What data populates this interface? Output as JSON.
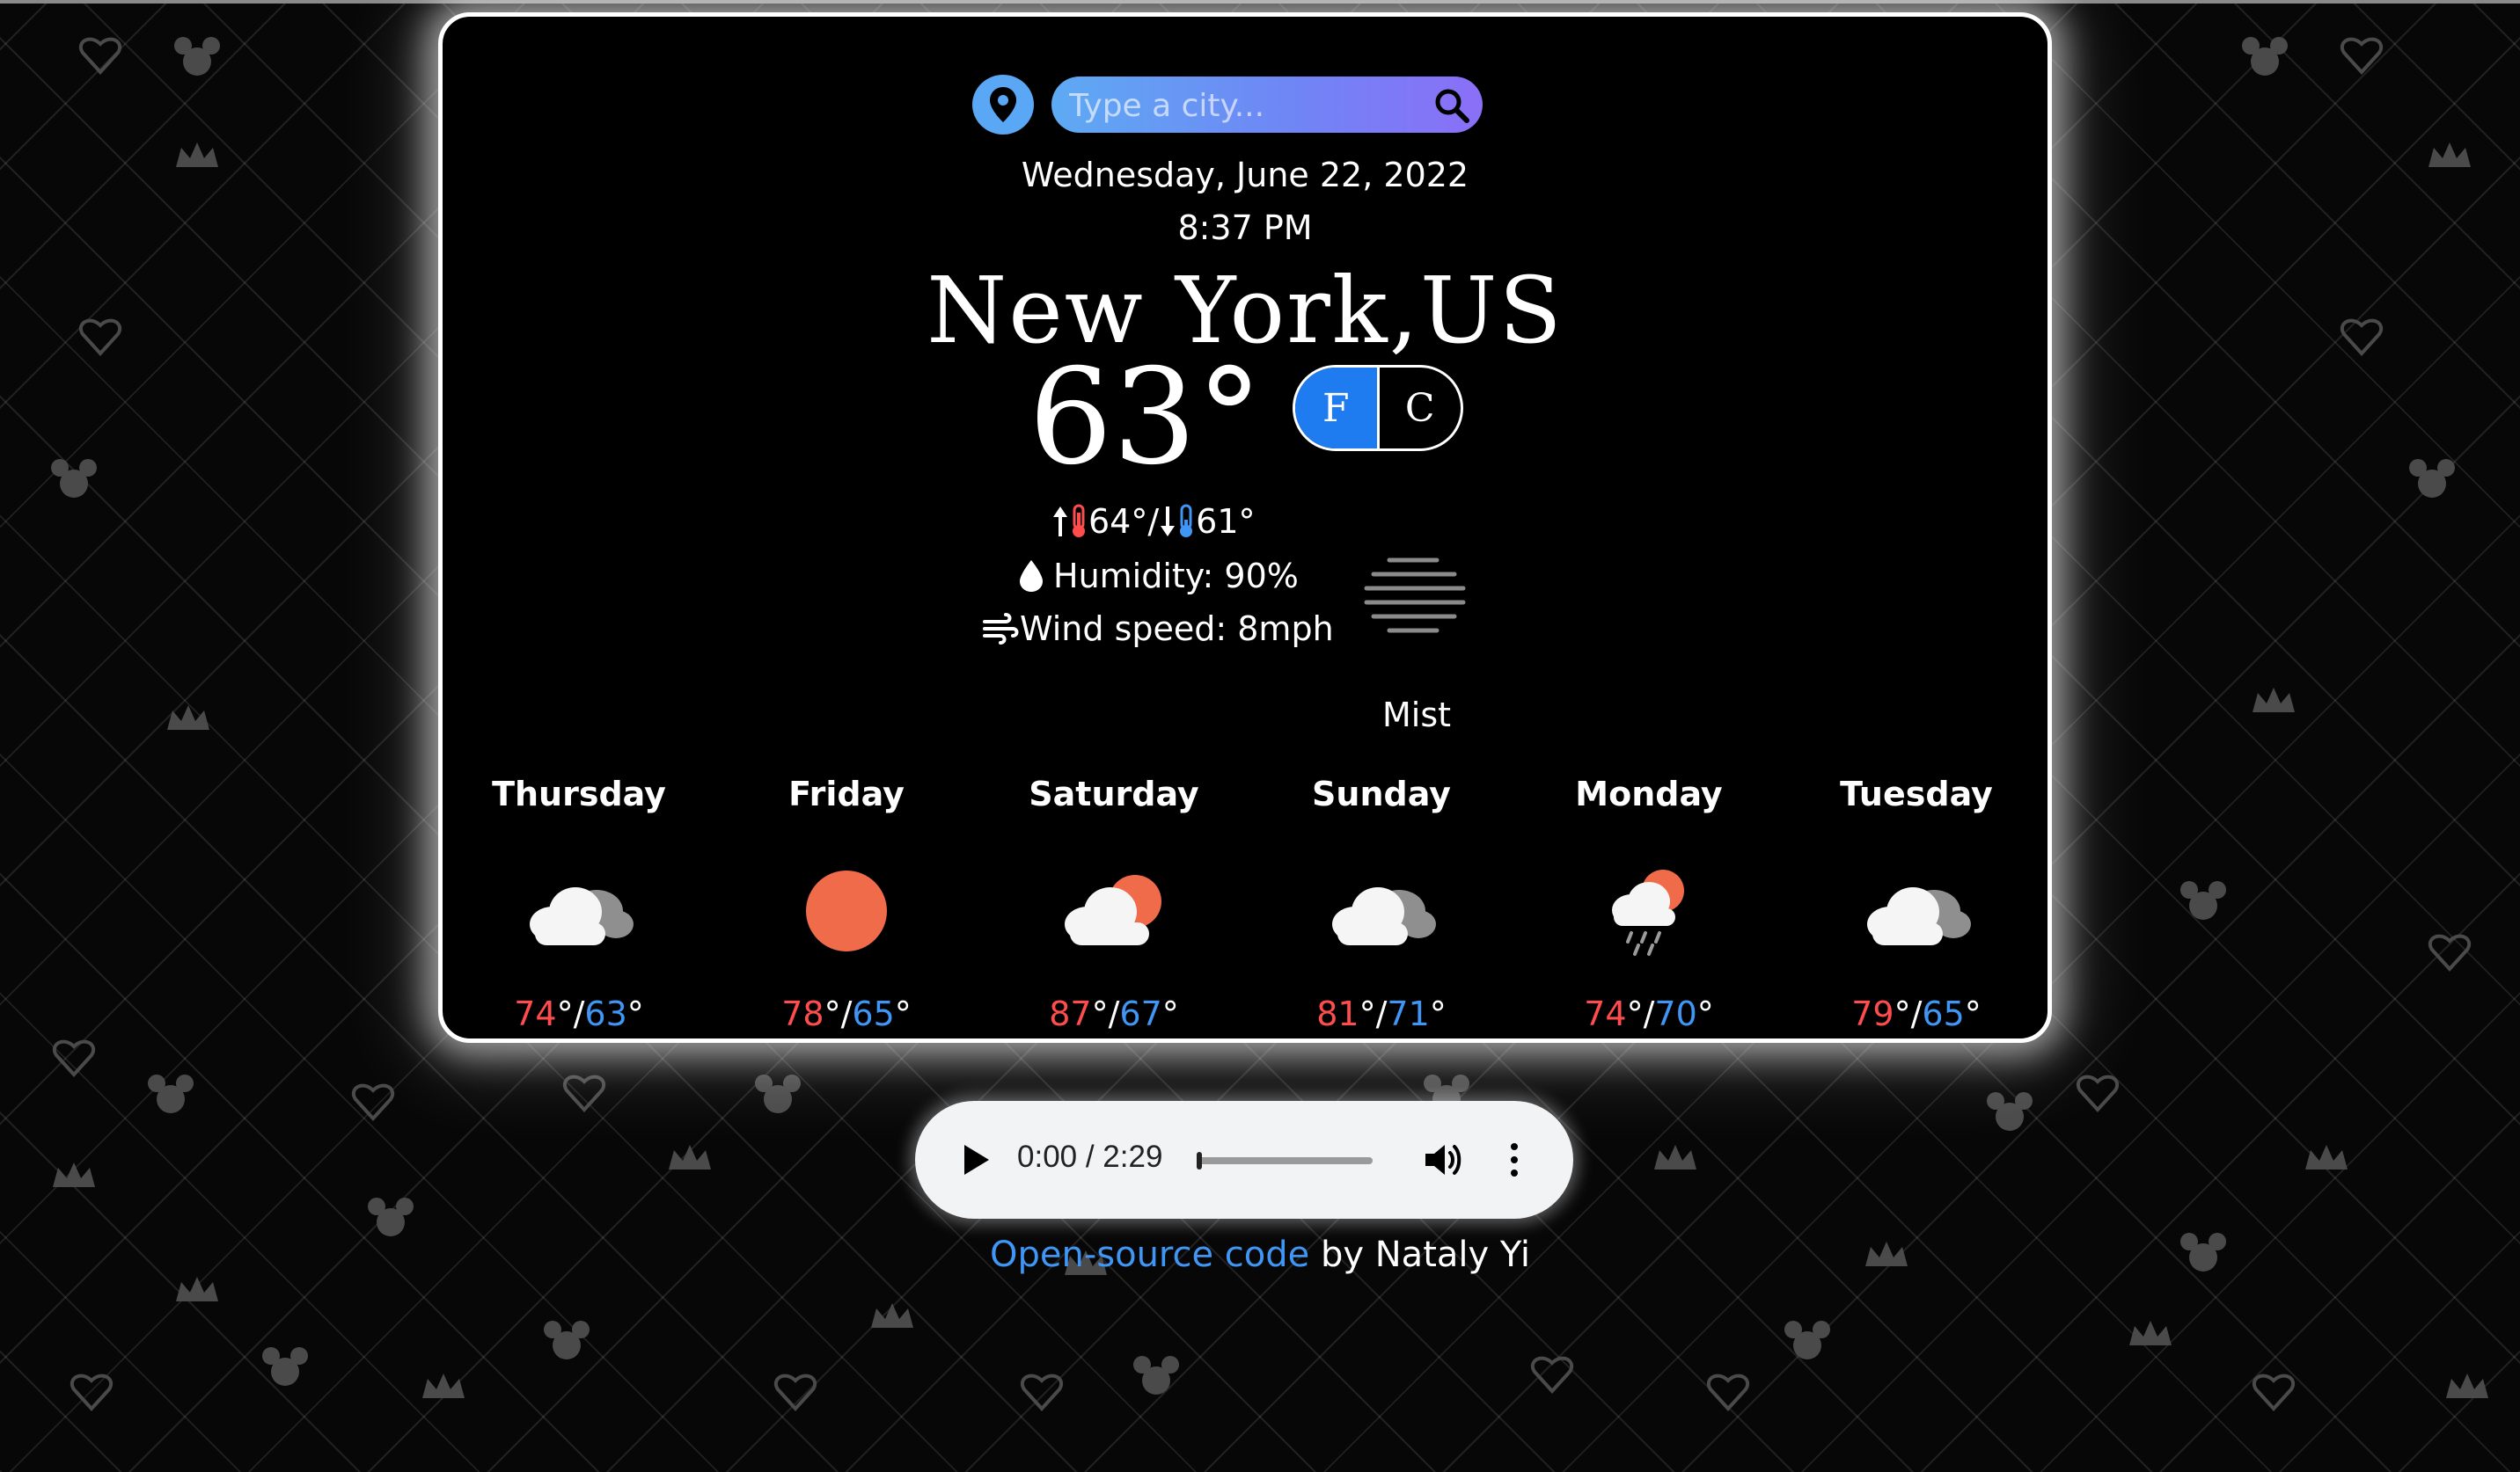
{
  "search": {
    "placeholder": "Type a city..."
  },
  "current": {
    "date": "Wednesday, June 22, 2022",
    "time": "8:37 PM",
    "city": "New York,US",
    "temperature": "63°",
    "unit_f": "F",
    "unit_c": "C",
    "active_unit": "F",
    "high": "64°",
    "separator": "/",
    "low": "61°",
    "humidity": "Humidity: 90%",
    "wind": "Wind speed: 8mph",
    "description": "Mist",
    "icon": "mist-icon"
  },
  "forecast": [
    {
      "day": "Thursday",
      "high": "74",
      "low": "63",
      "icon": "cloudy-icon"
    },
    {
      "day": "Friday",
      "high": "78",
      "low": "65",
      "icon": "sun-icon"
    },
    {
      "day": "Saturday",
      "high": "87",
      "low": "67",
      "icon": "partly-cloudy-icon"
    },
    {
      "day": "Sunday",
      "high": "81",
      "low": "71",
      "icon": "cloudy-icon"
    },
    {
      "day": "Monday",
      "high": "74",
      "low": "70",
      "icon": "rain-icon"
    },
    {
      "day": "Tuesday",
      "high": "79",
      "low": "65",
      "icon": "cloudy-icon"
    }
  ],
  "audio": {
    "time": "0:00 / 2:29",
    "progress": 0
  },
  "footer": {
    "link_text": "Open-source code",
    "by_text": " by Nataly Yi"
  },
  "colors": {
    "high": "#ff4c4c",
    "low": "#3f96f5",
    "accent": "#1f7cf0",
    "sun": "#ef6b4a"
  }
}
